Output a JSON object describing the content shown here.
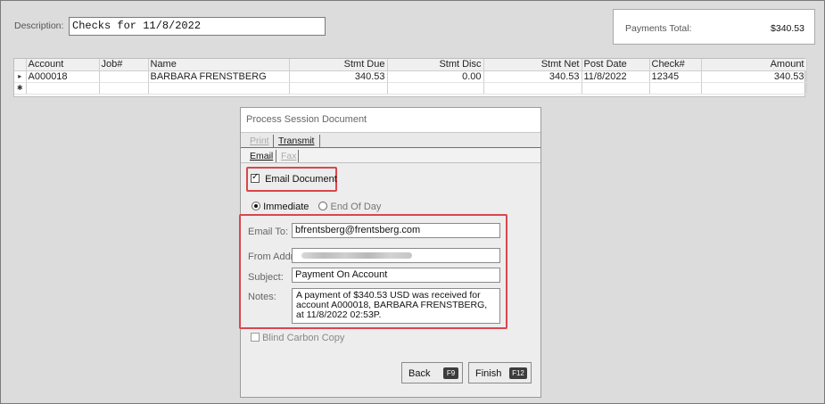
{
  "header": {
    "description_label": "Description:",
    "description_value": "Checks for 11/8/2022",
    "payments_total_label": "Payments Total:",
    "payments_total_value": "$340.53"
  },
  "grid": {
    "columns": [
      "Account",
      "Job#",
      "Name",
      "Stmt Due",
      "Stmt Disc",
      "Stmt Net",
      "Post Date",
      "Check#",
      "Amount"
    ],
    "rows": [
      {
        "account": "A000018",
        "job": "",
        "name": "BARBARA FRENSTBERG",
        "stmt_due": "340.53",
        "stmt_disc": "0.00",
        "stmt_net": "340.53",
        "post_date": "11/8/2022",
        "check": "12345",
        "amount": "340.53"
      }
    ],
    "current_row_marker": "▸",
    "new_row_marker": "✱"
  },
  "dialog": {
    "title": "Process Session Document",
    "tabs": [
      {
        "label": "Print",
        "active": false
      },
      {
        "label": "Transmit",
        "active": true
      }
    ],
    "subtabs": [
      {
        "label": "Email",
        "active": true
      },
      {
        "label": "Fax",
        "active": false
      }
    ],
    "email_document_label": "Email Document",
    "email_document_checked": true,
    "timing_options": [
      {
        "label": "Immediate",
        "selected": true
      },
      {
        "label": "End Of Day",
        "selected": false
      }
    ],
    "email_to_label": "Email To:",
    "email_to_value": "bfrentsberg@frentsberg.com",
    "from_addr_label": "From Addr:",
    "subject_label": "Subject:",
    "subject_value": "Payment On Account",
    "notes_label": "Notes:",
    "notes_value": "A payment of $340.53 USD was received for account A000018, BARBARA FRENSTBERG, at 11/8/2022 02:53P.",
    "blind_copy_label": "Blind Carbon Copy",
    "back_label": "Back",
    "back_key": "F9",
    "finish_label": "Finish",
    "finish_key": "F12"
  },
  "colors": {
    "highlight_border": "#d9474b",
    "window_background": "#dcdcdc"
  }
}
